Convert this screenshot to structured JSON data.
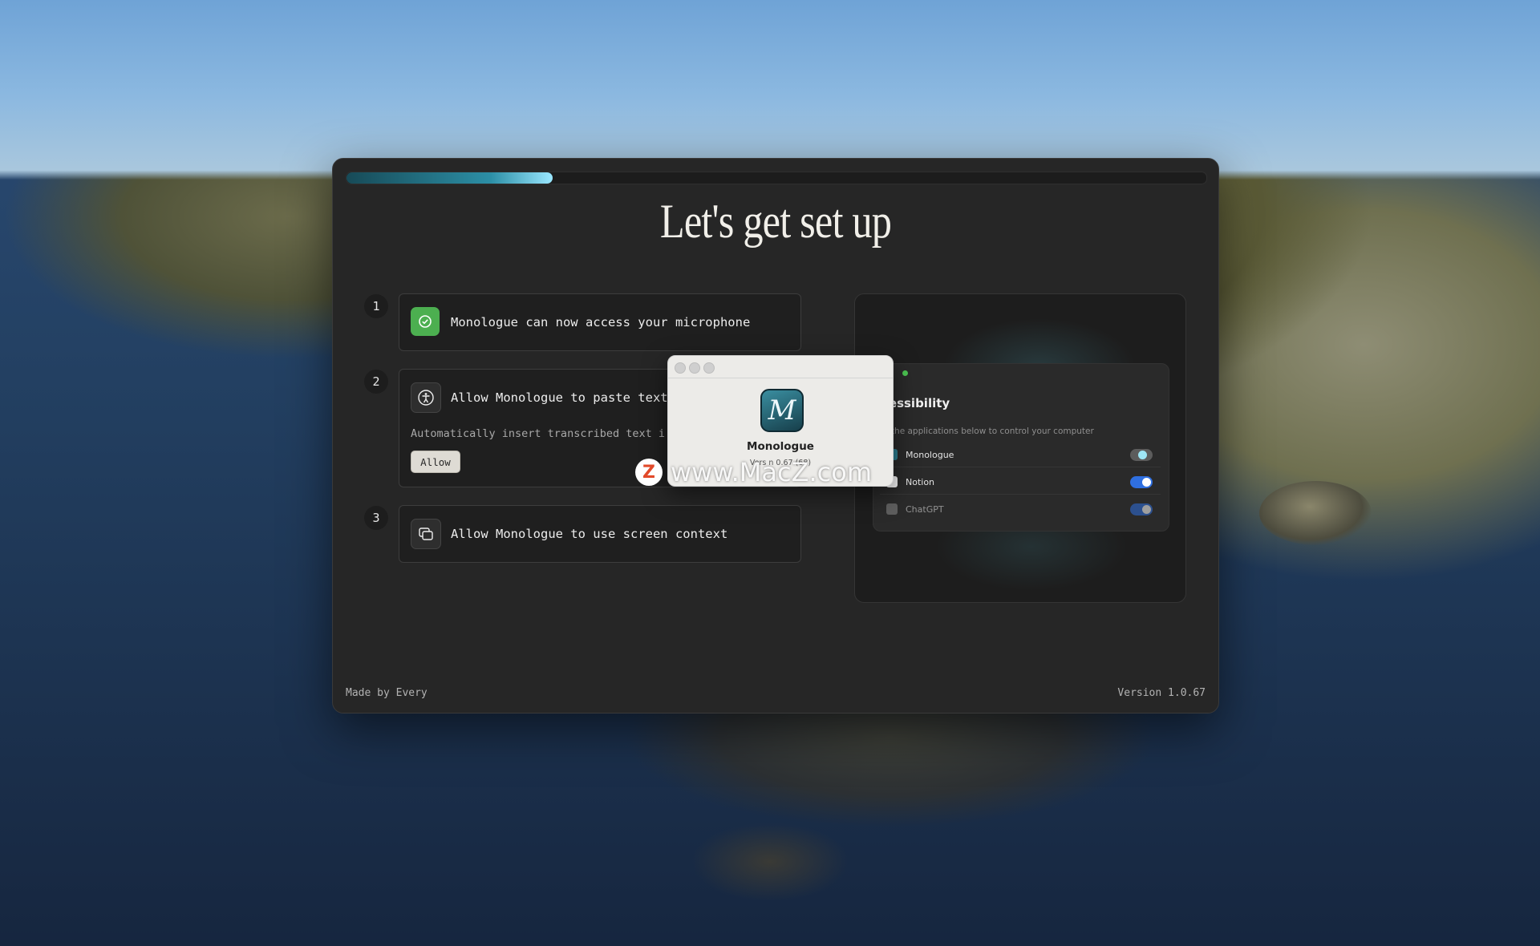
{
  "window": {
    "progress_fraction": 0.24,
    "title": "Let's get set up",
    "footer_left": "Made by Every",
    "footer_right": "Version 1.0.67"
  },
  "steps": [
    {
      "number": "1",
      "label": "Monologue can now access your microphone",
      "icon": "check-circle-icon",
      "status": "granted",
      "accent": "#4caf50"
    },
    {
      "number": "2",
      "label": "Allow Monologue to paste text",
      "description": "Automatically insert transcribed text i",
      "button": "Allow",
      "icon": "accessibility-icon"
    },
    {
      "number": "3",
      "label": "Allow Monologue to use screen context",
      "icon": "screens-icon"
    }
  ],
  "preview": {
    "settings_title": "cessibility",
    "settings_desc": "w the applications below to control your computer",
    "apps": [
      {
        "name": "Monologue",
        "enabled": true
      },
      {
        "name": "Notion",
        "enabled": true
      },
      {
        "name": "ChatGPT",
        "enabled": true
      }
    ]
  },
  "about": {
    "logo_letter": "M",
    "app_name": "Monologue",
    "version": "Vers  n  0.67 (68)"
  },
  "watermark": {
    "badge": "Z",
    "text": "www.MacZ.com"
  }
}
